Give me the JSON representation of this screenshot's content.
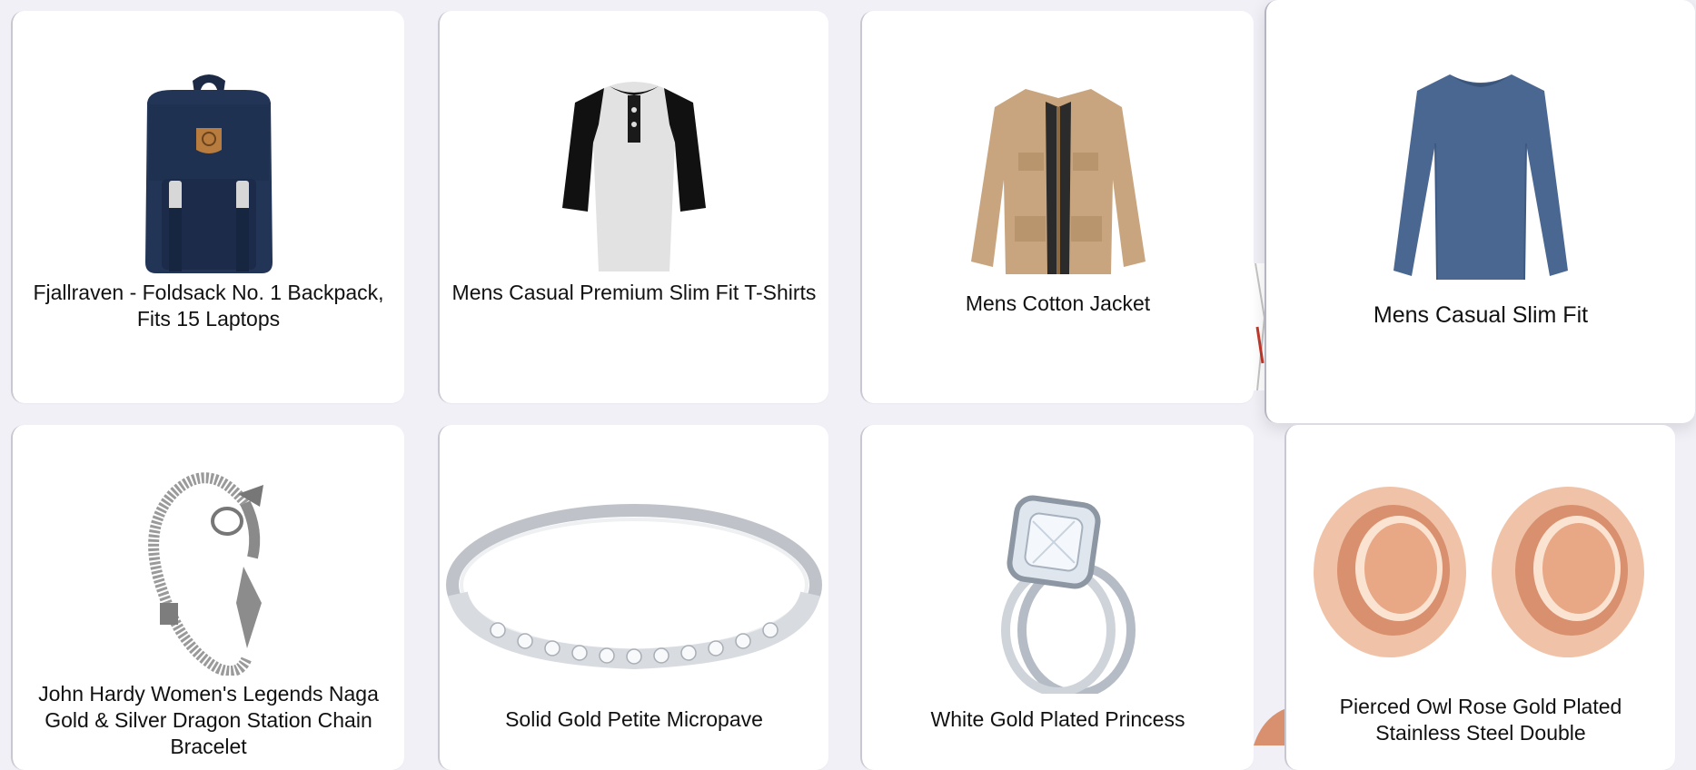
{
  "products": [
    {
      "title": "Fjallraven - Foldsack No. 1 Backpack, Fits 15 Laptops",
      "image": "backpack-image"
    },
    {
      "title": "Mens Casual Premium Slim Fit T-Shirts",
      "image": "tshirt-image"
    },
    {
      "title": "Mens Cotton Jacket",
      "image": "jacket-image"
    },
    {
      "title": "Mens Casual Slim Fit",
      "image": "longsleeve-image"
    },
    {
      "title": "John Hardy Women's Legends Naga Gold & Silver Dragon Station Chain Bracelet",
      "image": "bracelet-image"
    },
    {
      "title": "Solid Gold Petite Micropave",
      "image": "ring-band-image"
    },
    {
      "title": "White Gold Plated Princess",
      "image": "engagement-ring-image"
    },
    {
      "title": "Pierced Owl Rose Gold Plated Stainless Steel Double",
      "image": "tunnel-plugs-image"
    }
  ],
  "colors": {
    "page_bg": "#f1f0f7",
    "card_bg": "#ffffff",
    "backpack": "#1f2f4f",
    "jacket": "#c8a57e",
    "longsleeve": "#4a6791",
    "rose_gold": "#d9906e"
  }
}
